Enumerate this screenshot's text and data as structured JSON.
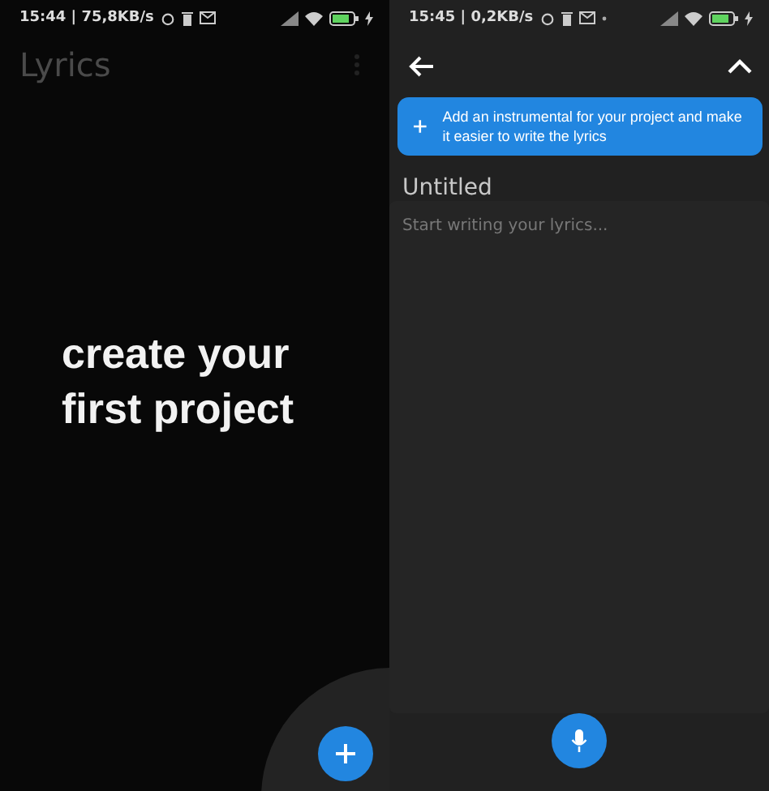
{
  "screens": [
    {
      "kind": "home",
      "status": {
        "time": "15:44 | 75,8KB/s",
        "dot": false
      },
      "title": "Lyrics",
      "message": "create your first project"
    },
    {
      "kind": "editor",
      "status": {
        "time": "15:45 | 0,2KB/s",
        "dot": true
      },
      "banner": "Add an instrumental for your project and make it easier to write the lyrics",
      "song_title": "Untitled",
      "placeholder": "Start writing your lyrics..."
    }
  ]
}
